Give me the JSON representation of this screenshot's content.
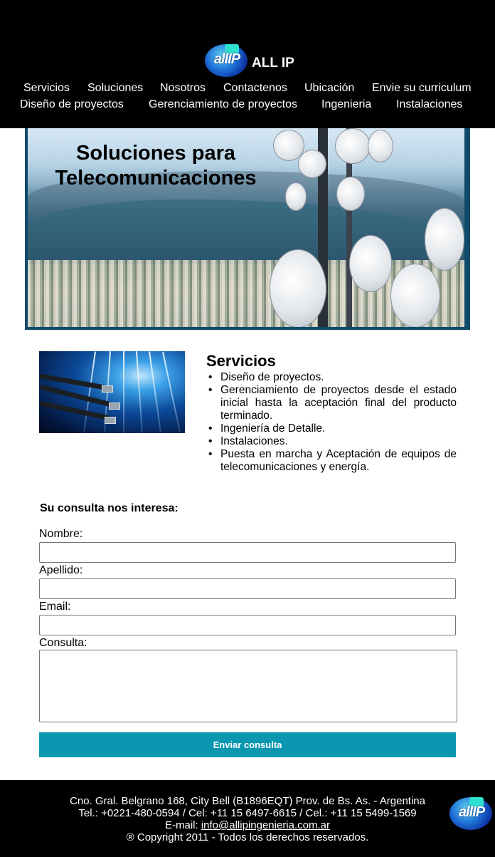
{
  "brand": {
    "logo_text": "allIP",
    "name": "ALL IP"
  },
  "nav": {
    "row1": [
      "Servicios",
      "Soluciones",
      "Nosotros",
      "Contactenos",
      "Ubicación",
      "Envie su curriculum"
    ],
    "row2": [
      "Diseño de proyectos",
      "Gerenciamiento de proyectos",
      "Ingenieria",
      "Instalaciones"
    ]
  },
  "hero": {
    "title_line1": "Soluciones para",
    "title_line2": "Telecomunicaciones"
  },
  "services": {
    "title": "Servicios",
    "items": [
      "Diseño de proyectos.",
      "Gerenciamiento de proyectos desde el estado inicial hasta la aceptación final del producto terminado.",
      "Ingeniería de Detalle.",
      "Instalaciones.",
      "Puesta en marcha y Aceptación de equipos de telecomunicaciones y energía."
    ]
  },
  "form": {
    "title": "Su consulta nos interesa:",
    "nombre_label": "Nombre:",
    "nombre_value": "",
    "apellido_label": "Apellido:",
    "apellido_value": "",
    "email_label": "Email:",
    "email_value": "",
    "consulta_label": "Consulta:",
    "consulta_value": "",
    "submit_label": "Enviar consulta"
  },
  "footer": {
    "address": "Cno. Gral. Belgrano 168, City Bell (B1896EQT) Prov. de Bs. As. - Argentina",
    "phones": "Tel.: +0221-480-0594 / Cel: +11 15 6497-6615 / Cel.: +11 15 5499-1569",
    "email_prefix": "E-mail: ",
    "email": "info@allipingenieria.com.ar",
    "copyright": "® Copyright 2011 - Todos los derechos reservados.",
    "logo_text": "allIP"
  },
  "colors": {
    "header_bg": "#000000",
    "button_bg": "#0b97b0",
    "footer_bg": "#000000"
  }
}
